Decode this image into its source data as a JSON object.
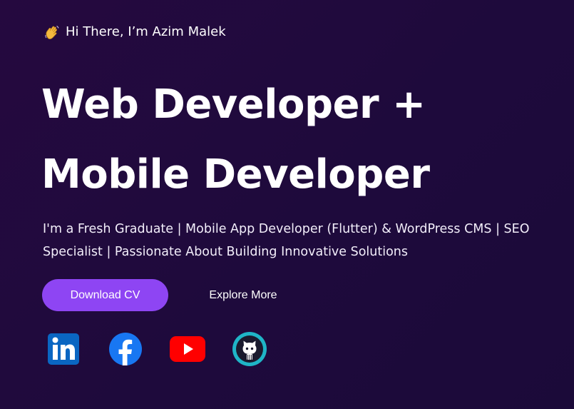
{
  "hero": {
    "greeting_text": "Hi There, I’m Azim Malek",
    "greeting_icon": "waving-hand-icon",
    "headline_line1": "Web Developer +",
    "headline_line2": "Mobile Developer",
    "tagline": "I'm a Fresh Graduate | Mobile App Developer (Flutter) & WordPress CMS | SEO Specialist | Passionate About Building Innovative Solutions",
    "primary_button_label": "Download CV",
    "secondary_button_label": "Explore More"
  },
  "social": [
    {
      "icon": "linkedin-icon",
      "color": "#0a66c2"
    },
    {
      "icon": "facebook-icon",
      "color": "#1877f2"
    },
    {
      "icon": "youtube-icon",
      "color": "#ff0000"
    },
    {
      "icon": "github-icon",
      "color": "#1fb5c7"
    }
  ],
  "colors": {
    "background": "#1e0a3c",
    "accent": "#8e45f3",
    "text": "#ffffff"
  }
}
